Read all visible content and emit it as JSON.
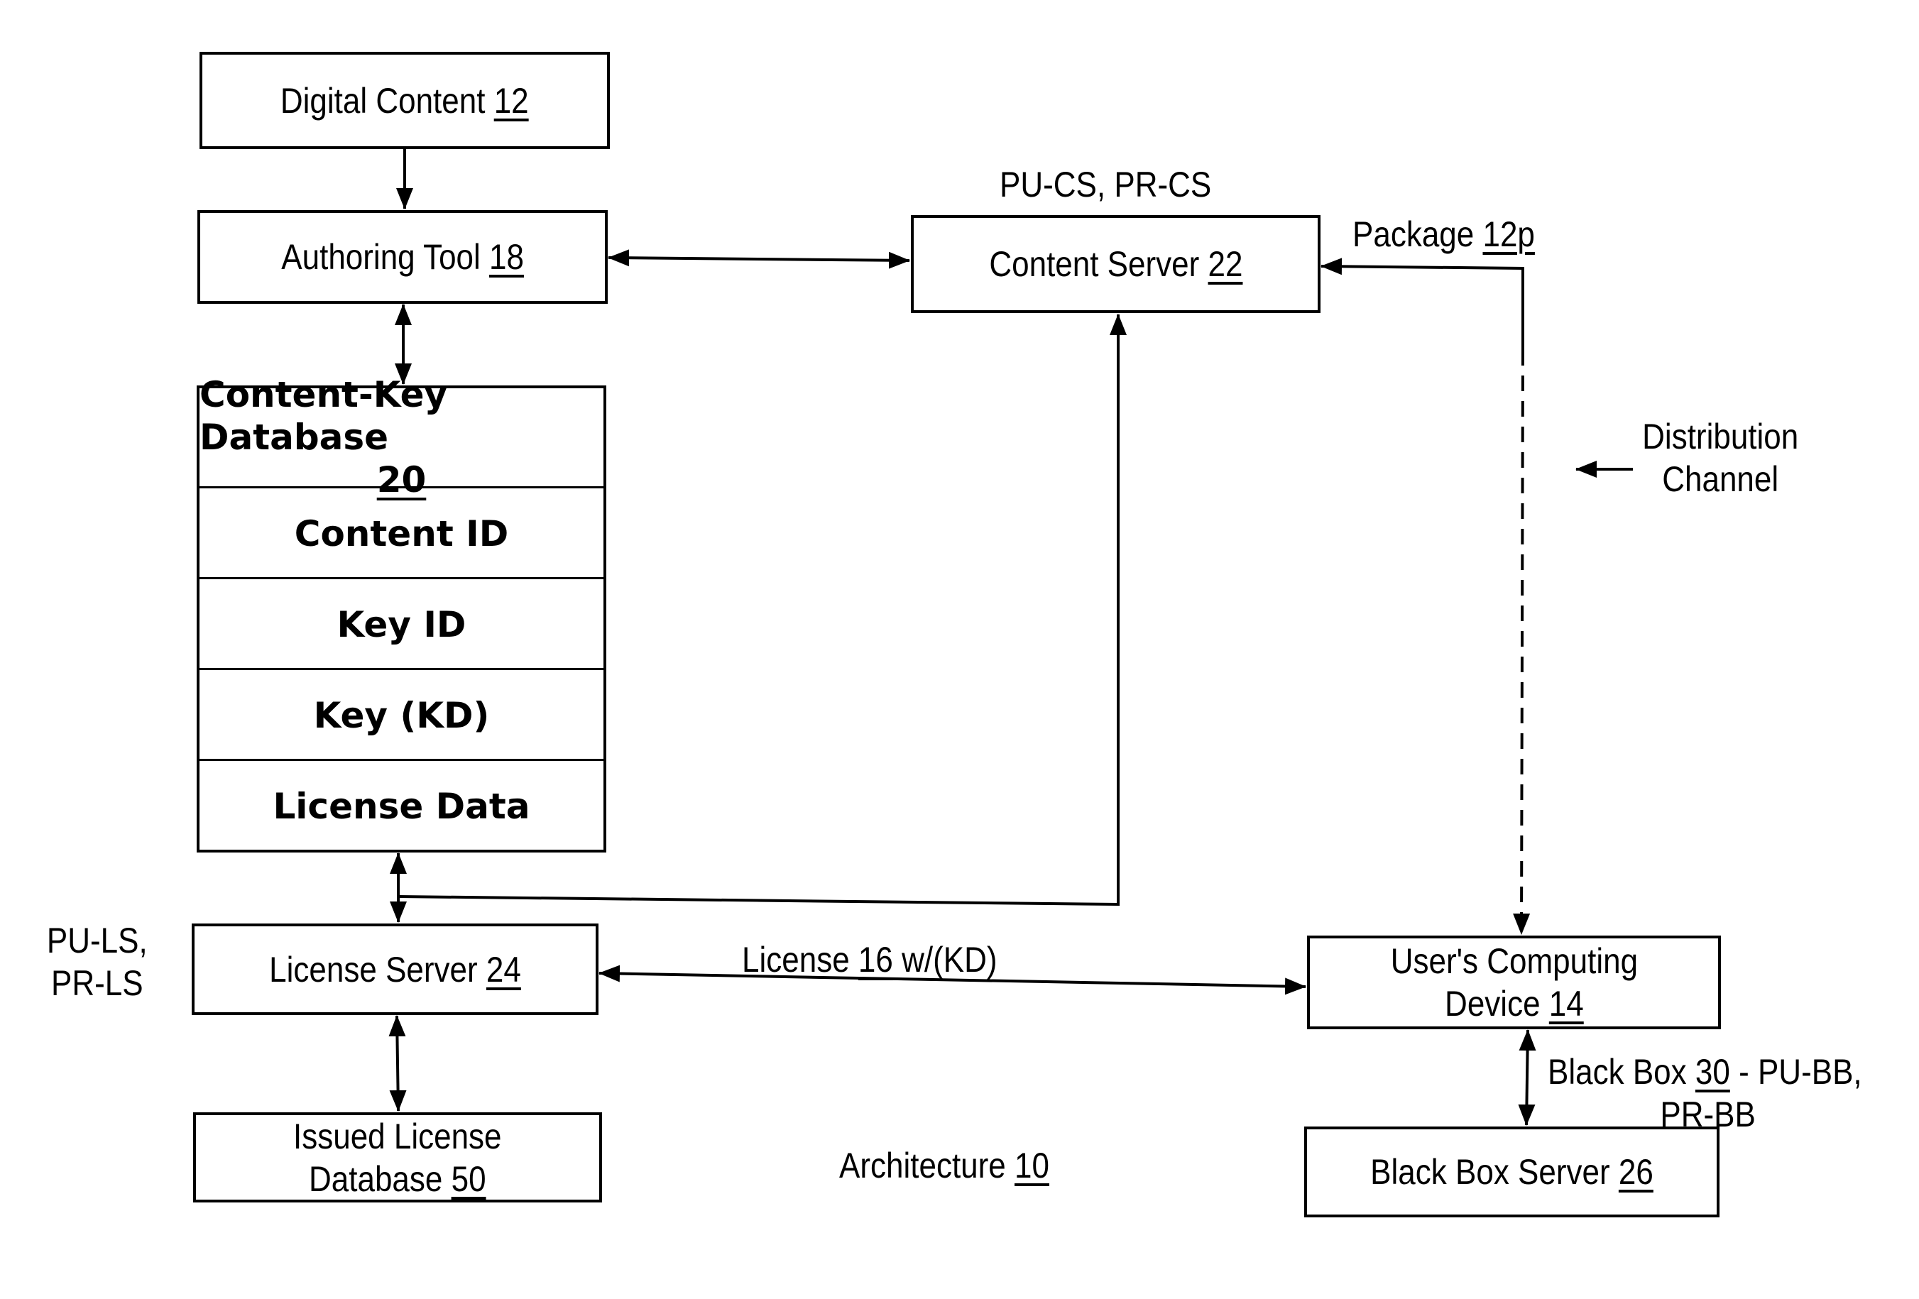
{
  "title": "Architecture",
  "title_ref": "10",
  "nodes": {
    "digital_content": {
      "label": "Digital Content",
      "ref": "12"
    },
    "authoring_tool": {
      "label": "Authoring Tool",
      "ref": "18"
    },
    "content_key_db": {
      "label": "Content-Key Database",
      "ref": "20",
      "fields": [
        "Content ID",
        "Key ID",
        "Key (KD)",
        "License Data"
      ]
    },
    "content_server": {
      "label": "Content Server",
      "ref": "22",
      "keys": "PU-CS, PR-CS"
    },
    "license_server": {
      "label": "License Server",
      "ref": "24",
      "keys_line1": "PU-LS,",
      "keys_line2": "PR-LS"
    },
    "issued_license_db": {
      "label_line1": "Issued License",
      "label_line2": "Database",
      "ref": "50"
    },
    "users_device": {
      "label_line1": "User's Computing",
      "label_line2": "Device",
      "ref": "14"
    },
    "black_box_server": {
      "label": "Black Box Server",
      "ref": "26"
    }
  },
  "edges": {
    "package": {
      "label": "Package",
      "ref": "12p"
    },
    "license": {
      "label_pre": "License",
      "ref": "16",
      "label_post": "w/(KD)"
    },
    "black_box": {
      "label_pre": "Black Box",
      "ref": "30",
      "label_post": "- PU-BB,",
      "line2": "PR-BB"
    },
    "distribution_channel": {
      "line1": "Distribution",
      "line2": "Channel"
    }
  }
}
